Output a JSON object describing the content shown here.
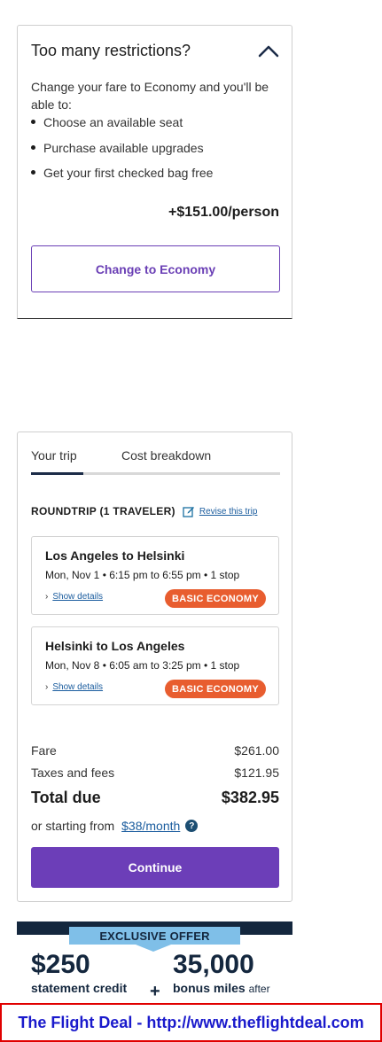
{
  "restrictions": {
    "title": "Too many restrictions?",
    "description": "Change your fare to Economy and you'll be able to:",
    "benefits": [
      "Choose an available seat",
      "Purchase available upgrades",
      "Get your first checked bag free"
    ],
    "price": "+$151.00/person",
    "button_label": "Change to Economy",
    "icon": "chevron-up-icon"
  },
  "trip": {
    "tabs": [
      "Your trip",
      "Cost breakdown"
    ],
    "roundtrip_label": "ROUNDTRIP (1 TRAVELER)",
    "revise_link": "Revise this trip",
    "segments": [
      {
        "route": "Los Angeles to Helsinki",
        "time": "Mon, Nov 1 • 6:15 pm to 6:55 pm • 1 stop",
        "details_link": "Show details",
        "badge": "BASIC ECONOMY"
      },
      {
        "route": "Helsinki to Los Angeles",
        "time": "Mon, Nov 8 • 6:05 am to 3:25 pm • 1 stop",
        "details_link": "Show details",
        "badge": "BASIC ECONOMY"
      }
    ],
    "fare_label": "Fare",
    "fare_value": "$261.00",
    "taxes_label": "Taxes and fees",
    "taxes_value": "$121.95",
    "total_label": "Total due",
    "total_value": "$382.95",
    "monthly_prefix": "or starting from",
    "monthly_amount": "$38/month",
    "help_glyph": "?",
    "continue_label": "Continue"
  },
  "offer": {
    "ribbon": "EXCLUSIVE OFFER",
    "amount1": "$250",
    "sub1": "statement credit",
    "plus": "+",
    "amount2": "35,000",
    "sub2": "bonus miles",
    "sub2_after": "after"
  },
  "footer": {
    "text": "The Flight Deal - http://www.theflightdeal.com"
  },
  "colors": {
    "accent_purple": "#6c3eb8",
    "badge_orange": "#e85d2f",
    "link_blue": "#1a5c9e",
    "navy": "#14273e",
    "footer_red": "#e00000",
    "footer_blue": "#1a1acc"
  }
}
